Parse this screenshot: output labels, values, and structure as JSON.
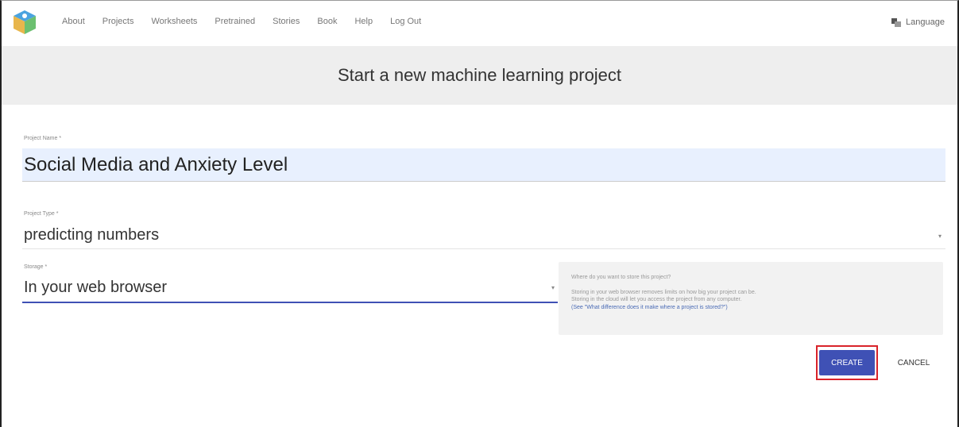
{
  "nav": {
    "logo_icon": "ml-cube-logo-icon",
    "items": [
      "About",
      "Projects",
      "Worksheets",
      "Pretrained",
      "Stories",
      "Book",
      "Help",
      "Log Out"
    ],
    "language_label": "Language",
    "language_icon": "translate-icon"
  },
  "header": {
    "title": "Start a new machine learning project"
  },
  "form": {
    "name_label": "Project Name *",
    "name_value": "Social Media and Anxiety Level",
    "type_label": "Project Type *",
    "type_value": "predicting numbers",
    "storage_label": "Storage *",
    "storage_value": "In your web browser"
  },
  "info": {
    "question": "Where do you want to store this project?",
    "line1": "Storing in your web browser removes limits on how big your project can be.",
    "line2": "Storing in the cloud will let you access the project from any computer.",
    "line3": "(See \"What difference does it make where a project is stored?\")"
  },
  "actions": {
    "create_label": "CREATE",
    "cancel_label": "CANCEL"
  },
  "colors": {
    "accent": "#3f51b5",
    "highlight": "#d9232a",
    "autofill": "#e8f0fe"
  }
}
